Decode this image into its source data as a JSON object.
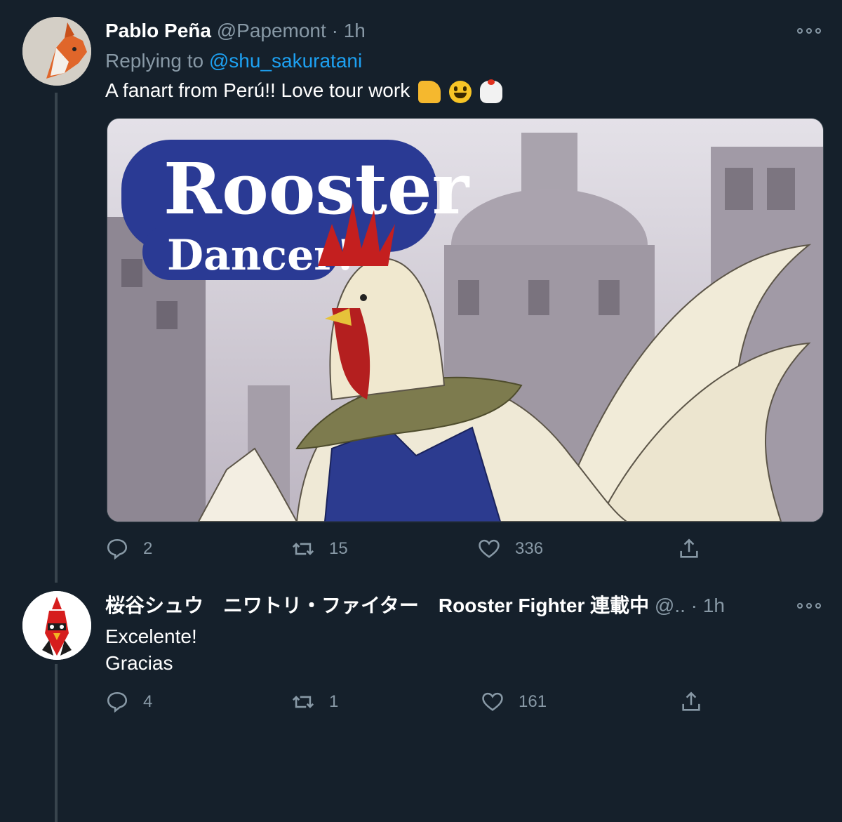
{
  "tweets": [
    {
      "author_name": "Pablo Peña",
      "handle": "@Papemont",
      "separator": "·",
      "time": "1h",
      "replying_label": "Replying to",
      "replying_to": "@shu_sakuratani",
      "text": "A fanart from Perú!! Love tour work",
      "emojis": [
        "thumbs-up-icon",
        "smile-icon",
        "rooster-icon"
      ],
      "media": {
        "title_line1": "Rooster",
        "title_line2": "Dancer!"
      },
      "stats": {
        "replies": "2",
        "retweets": "15",
        "likes": "336"
      }
    },
    {
      "author_name": "桜谷シュウ　ニワトリ・ファイター　Rooster Fighter 連載中",
      "handle": "@..",
      "separator": "·",
      "time": "1h",
      "text_line1": "Excelente!",
      "text_line2": "Gracias",
      "stats": {
        "replies": "4",
        "retweets": "1",
        "likes": "161"
      }
    }
  ],
  "colors": {
    "background": "#15202b",
    "secondary_text": "#8899a6",
    "link": "#1da1f2",
    "divider": "#38444d"
  }
}
